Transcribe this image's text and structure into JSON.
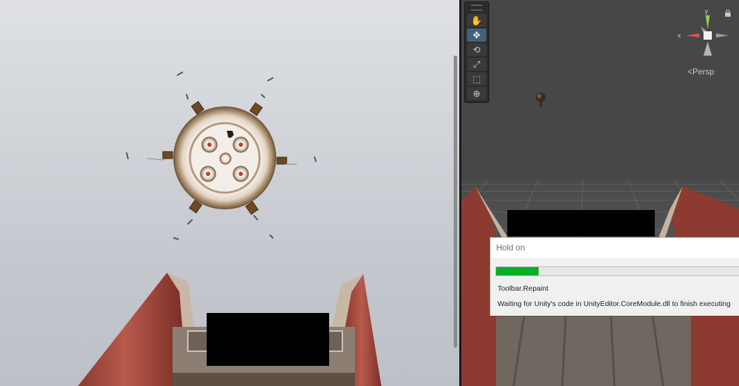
{
  "scene_view": {
    "persp_label": "<Persp",
    "gizmo_axes": {
      "x_label": "x",
      "y_label": "y"
    },
    "tools": [
      {
        "name": "hand-tool",
        "icon": "hand-icon",
        "glyph": "✋",
        "active": false
      },
      {
        "name": "move-tool",
        "icon": "move-arrows-icon",
        "glyph": "✥",
        "active": true
      },
      {
        "name": "rotate-tool",
        "icon": "rotate-icon",
        "glyph": "⟲",
        "active": false
      },
      {
        "name": "scale-tool",
        "icon": "scale-icon",
        "glyph": "⤢",
        "active": false
      },
      {
        "name": "rect-tool",
        "icon": "rect-transform-icon",
        "glyph": "⬚",
        "active": false
      },
      {
        "name": "transform-tool",
        "icon": "transform-icon",
        "glyph": "⊕",
        "active": false
      }
    ]
  },
  "dialog": {
    "title": "Hold on",
    "progress": 0.17,
    "task": "Toolbar.Repaint",
    "message": "Waiting for Unity's code in UnityEditor.CoreModule.dll to finish executing"
  },
  "colors": {
    "progress_green": "#06b025",
    "active_tool": "#46607c",
    "gizmo_x": "#d9534f",
    "gizmo_y": "#8fd14f"
  }
}
